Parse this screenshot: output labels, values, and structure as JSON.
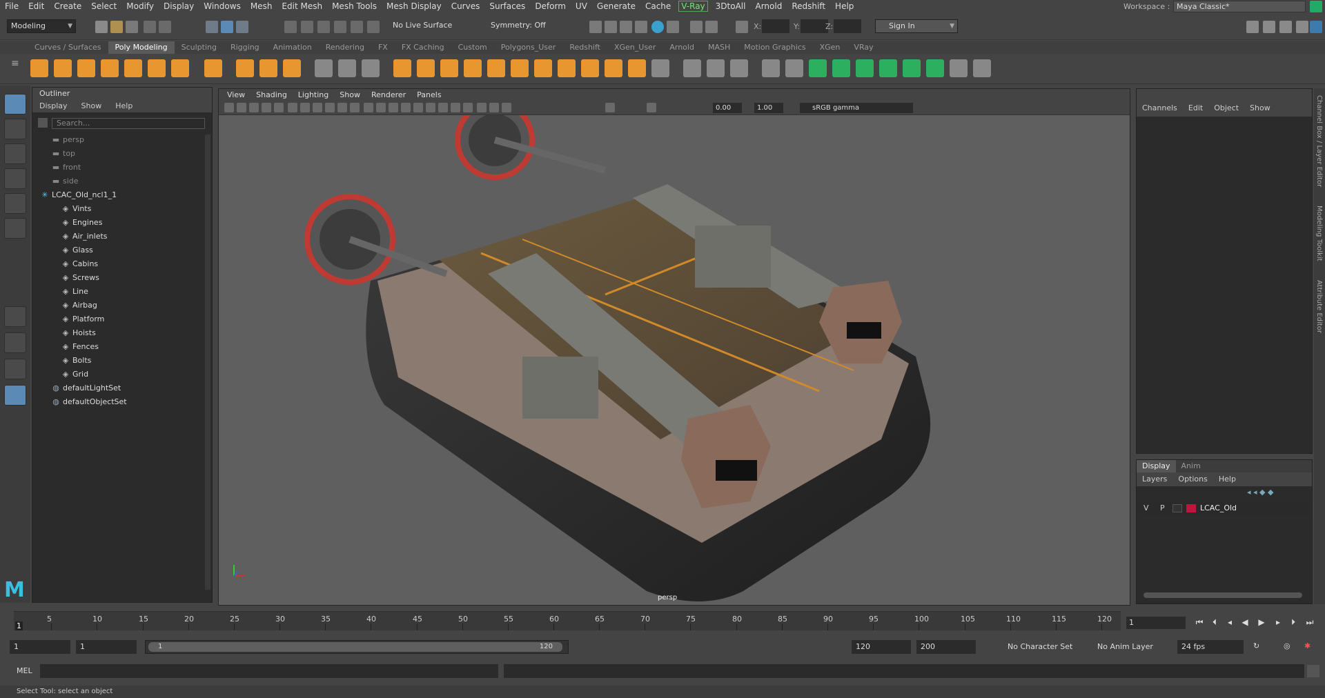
{
  "menubar": {
    "items": [
      "File",
      "Edit",
      "Create",
      "Select",
      "Modify",
      "Display",
      "Windows",
      "Mesh",
      "Edit Mesh",
      "Mesh Tools",
      "Mesh Display",
      "Curves",
      "Surfaces",
      "Deform",
      "UV",
      "Generate",
      "Cache",
      "V-Ray",
      "3DtoAll",
      "Arnold",
      "Redshift",
      "Help"
    ],
    "workspace_label": "Workspace :",
    "workspace_value": "Maya Classic*"
  },
  "statusline": {
    "mode": "Modeling",
    "live_surface": "No Live Surface",
    "symmetry": "Symmetry: Off",
    "x_label": "X:",
    "y_label": "Y:",
    "z_label": "Z:",
    "sign_in": "Sign In"
  },
  "shelf": {
    "tabs": [
      "Curves / Surfaces",
      "Poly Modeling",
      "Sculpting",
      "Rigging",
      "Animation",
      "Rendering",
      "FX",
      "FX Caching",
      "Custom",
      "Polygons_User",
      "Redshift",
      "XGen_User",
      "Arnold",
      "MASH",
      "Motion Graphics",
      "XGen",
      "VRay"
    ],
    "active_tab": "Poly Modeling",
    "accent": "#e89630"
  },
  "outliner": {
    "title": "Outliner",
    "menu": [
      "Display",
      "Show",
      "Help"
    ],
    "search_placeholder": "Search...",
    "cameras": [
      "persp",
      "top",
      "front",
      "side"
    ],
    "root": "LCAC_Old_ncl1_1",
    "children": [
      "Vints",
      "Engines",
      "Air_inlets",
      "Glass",
      "Cabins",
      "Screws",
      "Line",
      "Airbag",
      "Platform",
      "Hoists",
      "Fences",
      "Bolts",
      "Grid"
    ],
    "sets": [
      "defaultLightSet",
      "defaultObjectSet"
    ]
  },
  "viewport": {
    "menu": [
      "View",
      "Shading",
      "Lighting",
      "Show",
      "Renderer",
      "Panels"
    ],
    "exposure": "0.00",
    "gamma": "1.00",
    "color_space": "sRGB gamma",
    "camera_label": "persp"
  },
  "channelbox": {
    "menu": [
      "Channels",
      "Edit",
      "Object",
      "Show"
    ]
  },
  "layer_editor": {
    "tabs": [
      "Display",
      "Anim"
    ],
    "active_tab": "Display",
    "menu": [
      "Layers",
      "Options",
      "Help"
    ],
    "layer": {
      "v": "V",
      "p": "P",
      "name": "LCAC_Old",
      "color": "#c0143c"
    }
  },
  "right_strip": [
    "Channel Box / Layer Editor",
    "Modeling Toolkit",
    "Attribute Editor"
  ],
  "timeline": {
    "ticks": [
      5,
      10,
      15,
      20,
      25,
      30,
      35,
      40,
      45,
      50,
      55,
      60,
      65,
      70,
      75,
      80,
      85,
      90,
      95,
      100,
      105,
      110,
      115,
      120
    ],
    "start_label": "1",
    "current_frame": "1"
  },
  "range": {
    "start": "1",
    "playback_start": "1",
    "slider_start": "1",
    "slider_end": "120",
    "playback_end": "120",
    "end": "200",
    "character_set": "No Character Set",
    "anim_layer": "No Anim Layer",
    "fps": "24 fps"
  },
  "mel": {
    "label": "MEL"
  },
  "help_line": "Select Tool: select an object"
}
